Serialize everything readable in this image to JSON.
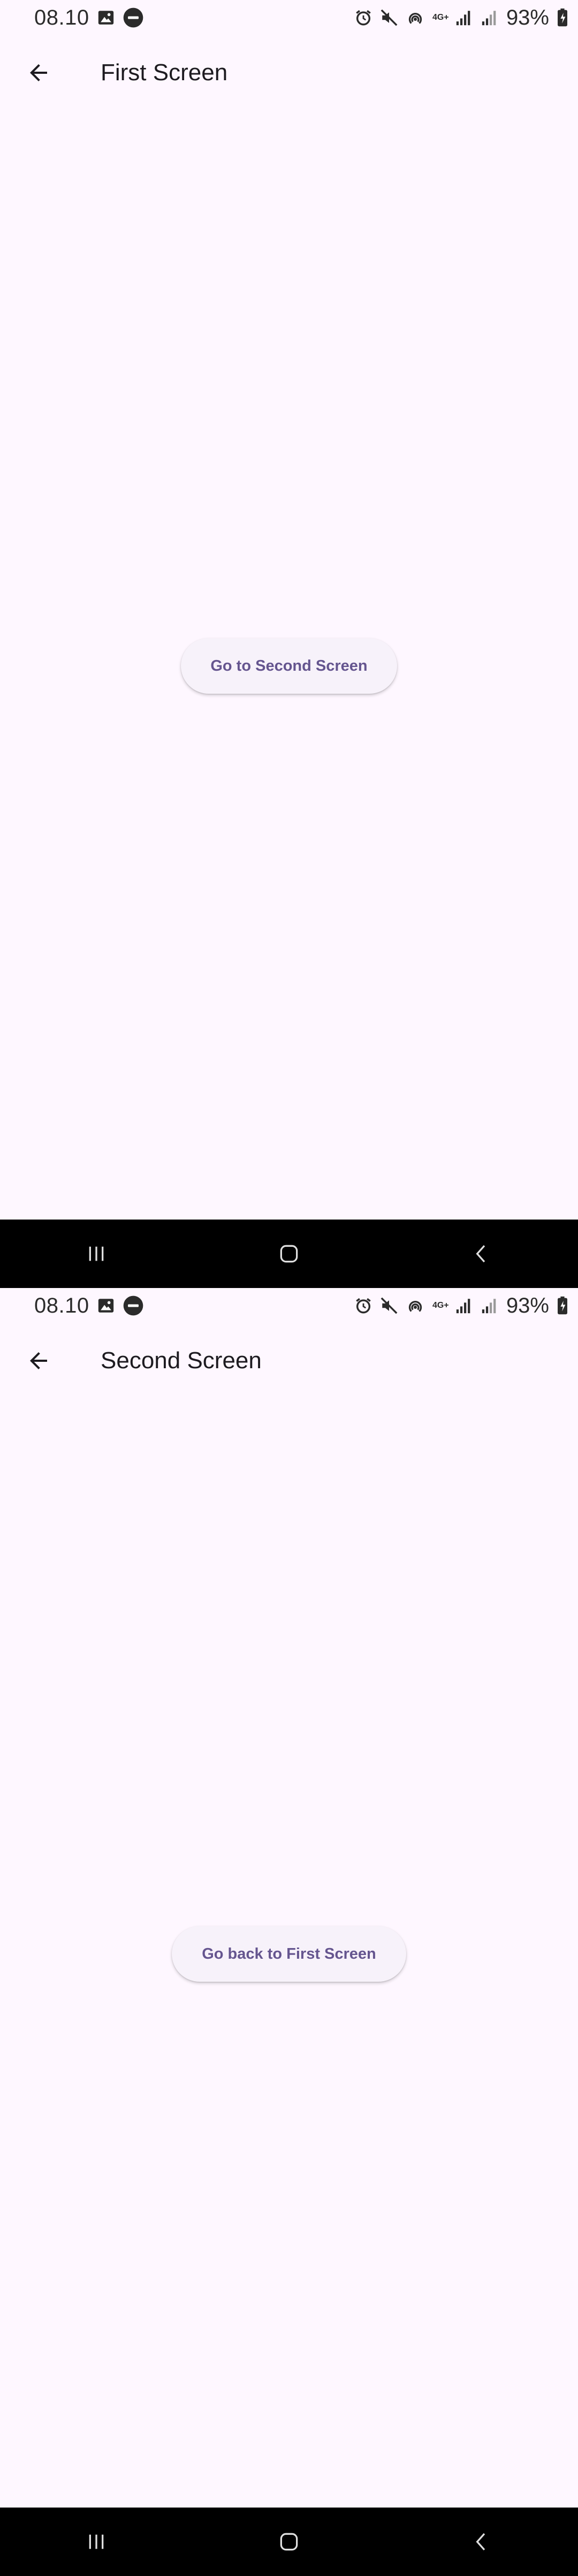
{
  "screens": [
    {
      "status": {
        "time": "08.10",
        "net_type": "4G+",
        "battery": "93%"
      },
      "app_bar": {
        "title": "First Screen"
      },
      "button": {
        "label": "Go to Second Screen"
      }
    },
    {
      "status": {
        "time": "08.10",
        "net_type": "4G+",
        "battery": "93%"
      },
      "app_bar": {
        "title": "Second Screen"
      },
      "button": {
        "label": "Go back to First Screen"
      }
    }
  ],
  "colors": {
    "background": "#fef7ff",
    "button_surface": "#f7f2fa",
    "button_text": "#65558f",
    "nav_bar": "#000000"
  },
  "icons": [
    "image-icon",
    "dnd-icon",
    "alarm-icon",
    "mute-icon",
    "hotspot-icon",
    "signal-icon",
    "battery-icon",
    "arrow-back-icon",
    "recents-icon",
    "home-icon",
    "back-icon"
  ]
}
